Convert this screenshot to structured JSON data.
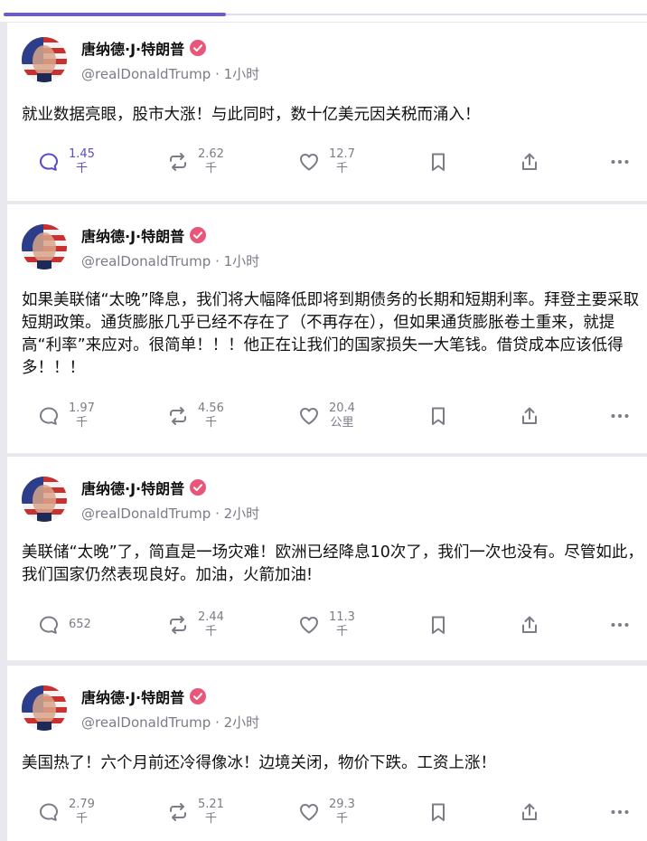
{
  "nav": {
    "accent": "#6a5fc1"
  },
  "posts": [
    {
      "author": "唐纳德·J·特朗普",
      "handle": "@realDonaldTrump",
      "time": "1小时",
      "text": "就业数据亮眼，股市大涨！与此同时，数十亿美元因关税而涌入！",
      "replies": "1.45\n千",
      "reposts": "2.62\n千",
      "likes": "12.7\n千",
      "reply_active": true
    },
    {
      "author": "唐纳德·J·特朗普",
      "handle": "@realDonaldTrump",
      "time": "1小时",
      "text": "如果美联储“太晚”降息，我们将大幅降低即将到期债务的长期和短期利率。拜登主要采取短期政策。通货膨胀几乎已经不存在了（不再存在），但如果通货膨胀卷土重来，就提高“利率”来应对。很简单！！！他正在让我们的国家损失一大笔钱。借贷成本应该低得多！！！",
      "replies": "1.97\n千",
      "reposts": "4.56\n千",
      "likes": "20.4\n公里",
      "reply_active": false
    },
    {
      "author": "唐纳德·J·特朗普",
      "handle": "@realDonaldTrump",
      "time": "2小时",
      "text": "美联储“太晚”了，简直是一场灾难！欧洲已经降息10次了，我们一次也没有。尽管如此，我们国家仍然表现良好。加油，火箭加油!",
      "replies": "652",
      "reposts": "2.44\n千",
      "likes": "11.3\n千",
      "reply_active": false
    },
    {
      "author": "唐纳德·J·特朗普",
      "handle": "@realDonaldTrump",
      "time": "2小时",
      "text": "美国热了！六个月前还冷得像冰！边境关闭，物价下跌。工资上涨！",
      "replies": "2.79\n千",
      "reposts": "5.21\n千",
      "likes": "29.3\n千",
      "reply_active": false
    }
  ],
  "icons": {
    "reply": "reply-icon",
    "repost": "repost-icon",
    "like": "heart-icon",
    "bookmark": "bookmark-icon",
    "share": "share-icon",
    "more": "more-icon",
    "verified": "verified-badge-icon"
  },
  "colors": {
    "verified": "#e8577a",
    "active": "#5b4fc4",
    "muted": "#7d7b86"
  }
}
